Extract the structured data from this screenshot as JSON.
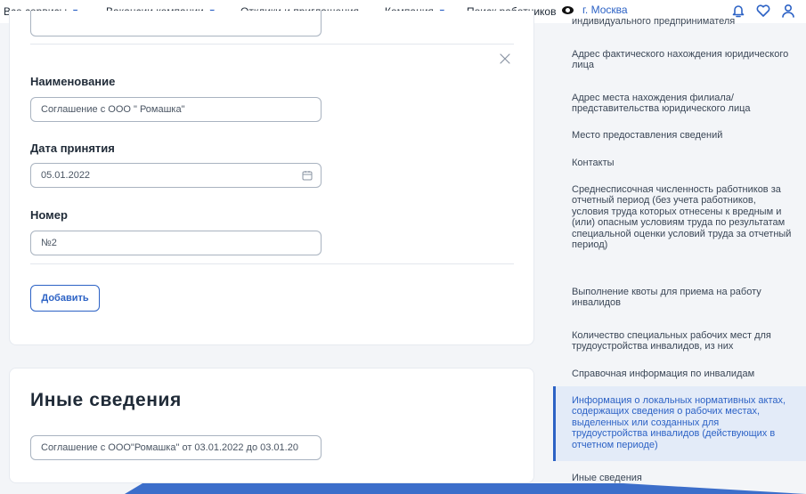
{
  "topnav": {
    "all_services": "Все сервисы",
    "company_vacancies": "Вакансии компании",
    "responses": "Отклики и приглашения",
    "company": "Компания",
    "search_workers": "Поиск работников",
    "city": "г. Москва"
  },
  "form": {
    "name_label": "Наименование",
    "name_value": "Соглашение с ООО \" Ромашка\"",
    "date_label": "Дата принятия",
    "date_value": "05.01.2022",
    "number_label": "Номер",
    "number_value": "№2",
    "add_button": "Добавить"
  },
  "other_info": {
    "title": "Иные сведения",
    "value": "Соглашение с ООО\"Ромашка\" от 03.01.2022 до 03.01.20"
  },
  "sidebar": {
    "items": [
      {
        "label": "индивидуального предпринимателя"
      },
      {
        "label": "Адрес фактического нахождения юридического лица"
      },
      {
        "label": "Адрес места нахождения филиала/ представительства юридического лица"
      },
      {
        "label": "Место предоставления сведений"
      },
      {
        "label": "Контакты"
      },
      {
        "label": "Среднесписочная численность работников за отчетный период (без учета работников, условия труда которых отнесены к вредным и (или) опасным условиям труда по результатам специальной оценки условий труда за отчетный период)"
      },
      {
        "label": "Выполнение квоты для приема на работу инвалидов"
      },
      {
        "label": "Количество специальных рабочих мест для трудоустройства инвалидов, из них"
      },
      {
        "label": "Справочная информация по инвалидам"
      },
      {
        "label": "Информация о локальных нормативных актах, содержащих сведения о рабочих местах, выделенных или созданных для трудоустройства инвалидов (действующих в отчетном периоде)"
      },
      {
        "label": "Иные сведения"
      }
    ]
  },
  "icons": [
    "chevron-down-icon",
    "eye-icon",
    "bell-icon",
    "heart-icon",
    "user-icon",
    "close-icon",
    "calendar-icon"
  ],
  "colors": {
    "accent": "#2c62c5",
    "active_bg": "#e3ebf8",
    "page_bg": "#f3f5f8"
  }
}
